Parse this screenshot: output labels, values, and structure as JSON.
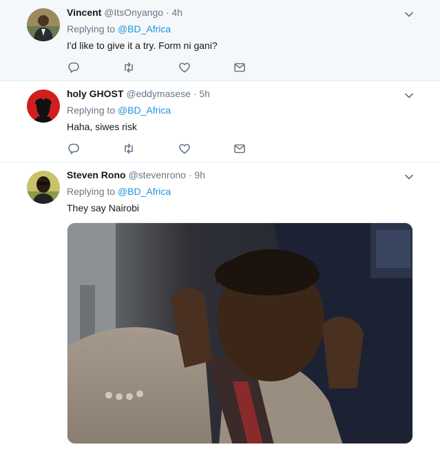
{
  "tweets": [
    {
      "name": "Vincent",
      "handle": "@ItsOnyango",
      "separator": "·",
      "time": "4h",
      "replying_prefix": "Replying to",
      "replying_to": "@BD_Africa",
      "text": "I'd like to give it a try. Form ni gani?"
    },
    {
      "name": "holy GHOST",
      "handle": "@eddymasese",
      "separator": "·",
      "time": "5h",
      "replying_prefix": "Replying to",
      "replying_to": "@BD_Africa",
      "text": "Haha, siwes risk"
    },
    {
      "name": "Steven Rono",
      "handle": "@stevenrono",
      "separator": "·",
      "time": "9h",
      "replying_prefix": "Replying to",
      "replying_to": "@BD_Africa",
      "text": "They say Nairobi"
    }
  ],
  "icons": {
    "reply": "reply-icon",
    "retweet": "retweet-icon",
    "like": "like-icon",
    "message": "direct-message-icon",
    "more": "chevron-down-icon"
  },
  "colors": {
    "accent": "#1b95e0",
    "muted": "#657786",
    "text": "#14171a",
    "highlight_bg": "#f5f8fa"
  }
}
